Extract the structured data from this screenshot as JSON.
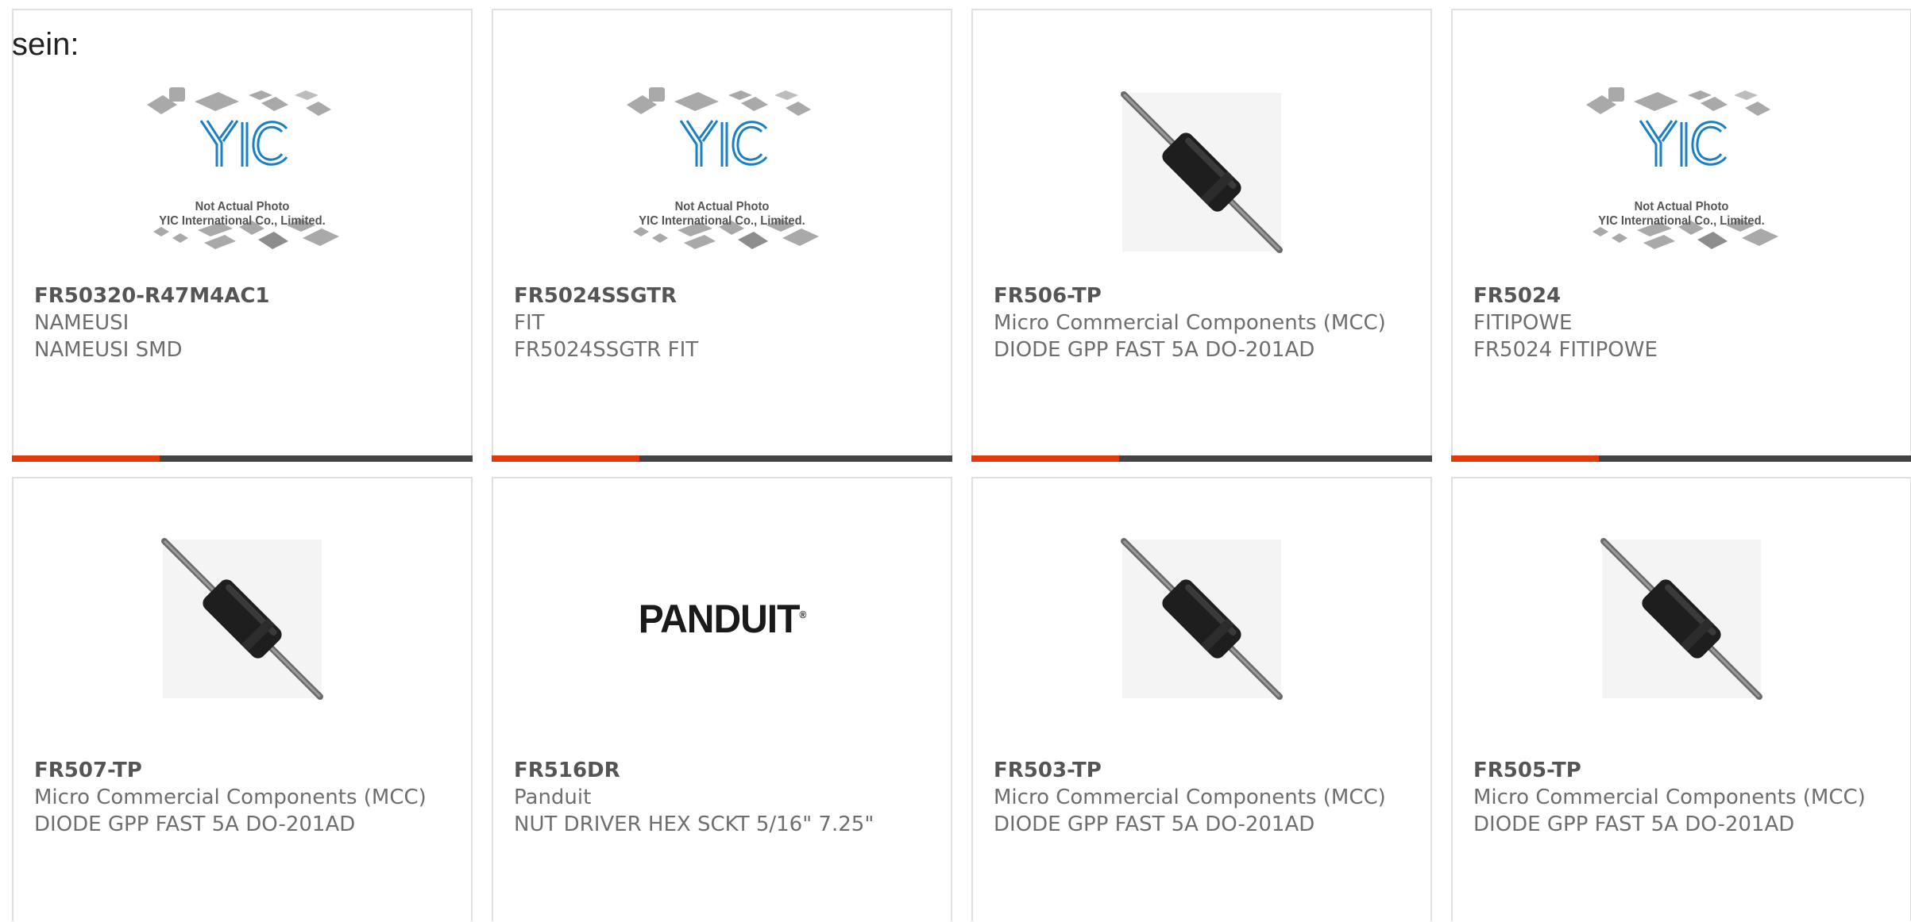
{
  "lead_text": "sein:",
  "products": [
    {
      "part_number": "FR50320-R47M4AC1",
      "manufacturer": "NAMEUSI",
      "description": "NAMEUSI SMD",
      "image": "yic-placeholder",
      "image_caption_line1": "Not Actual Photo",
      "image_caption_line2": "YIC International Co., Limited."
    },
    {
      "part_number": "FR5024SSGTR",
      "manufacturer": "FIT",
      "description": "FR5024SSGTR FIT",
      "image": "yic-placeholder",
      "image_caption_line1": "Not Actual Photo",
      "image_caption_line2": "YIC International Co., Limited."
    },
    {
      "part_number": "FR506-TP",
      "manufacturer": "Micro Commercial Components (MCC)",
      "description": "DIODE GPP FAST 5A DO-201AD",
      "image": "axial-diode"
    },
    {
      "part_number": "FR5024",
      "manufacturer": "FITIPOWE",
      "description": "FR5024 FITIPOWE",
      "image": "yic-placeholder",
      "image_caption_line1": "Not Actual Photo",
      "image_caption_line2": "YIC International Co., Limited."
    },
    {
      "part_number": "FR507-TP",
      "manufacturer": "Micro Commercial Components (MCC)",
      "description": "DIODE GPP FAST 5A DO-201AD",
      "image": "axial-diode"
    },
    {
      "part_number": "FR516DR",
      "manufacturer": "Panduit",
      "description": "NUT DRIVER HEX SCKT 5/16\" 7.25\"",
      "image": "panduit-logo",
      "logo_text": "PANDUIT"
    },
    {
      "part_number": "FR503-TP",
      "manufacturer": "Micro Commercial Components (MCC)",
      "description": "DIODE GPP FAST 5A DO-201AD",
      "image": "axial-diode"
    },
    {
      "part_number": "FR505-TP",
      "manufacturer": "Micro Commercial Components (MCC)",
      "description": "DIODE GPP FAST 5A DO-201AD",
      "image": "axial-diode"
    }
  ],
  "colors": {
    "accent": "#e2390c",
    "bar": "#444444",
    "border": "#e0e0e0",
    "yic_blue": "#1b7fc4"
  }
}
